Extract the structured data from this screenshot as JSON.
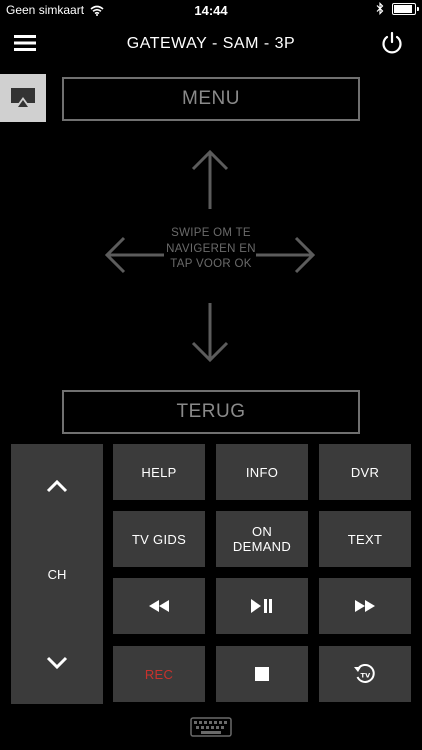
{
  "status_bar": {
    "carrier": "Geen simkaart",
    "time": "14:44",
    "battery_level": 0.92
  },
  "nav": {
    "title": "GATEWAY - SAM - 3P"
  },
  "remote": {
    "menu_label": "MENU",
    "swipe_hint": "SWIPE OM TE NAVIGEREN EN TAP VOOR OK",
    "back_label": "TERUG",
    "ch_label": "CH",
    "help_label": "HELP",
    "info_label": "INFO",
    "dvr_label": "DVR",
    "tv_gids_label": "TV GIDS",
    "on_demand_label": "ON DEMAND",
    "text_label": "TEXT",
    "rec_label": "REC"
  },
  "icons": {
    "wifi": "wifi-icon",
    "bluetooth": "bluetooth-icon",
    "battery": "battery-icon",
    "menu": "hamburger-menu-icon",
    "power": "power-icon",
    "airplay": "airplay-icon",
    "up": "arrow-up-icon",
    "down": "arrow-down-icon",
    "left": "arrow-left-icon",
    "right": "arrow-right-icon",
    "rewind": "rewind-icon",
    "play_pause": "play-pause-icon",
    "fast_forward": "fast-forward-icon",
    "stop": "stop-icon",
    "replay": "replay-tv-icon",
    "keyboard": "keyboard-icon"
  },
  "colors": {
    "background": "#000000",
    "button_bg": "#3b3b3b",
    "outline": "#707070",
    "rec": "#c8322d"
  }
}
